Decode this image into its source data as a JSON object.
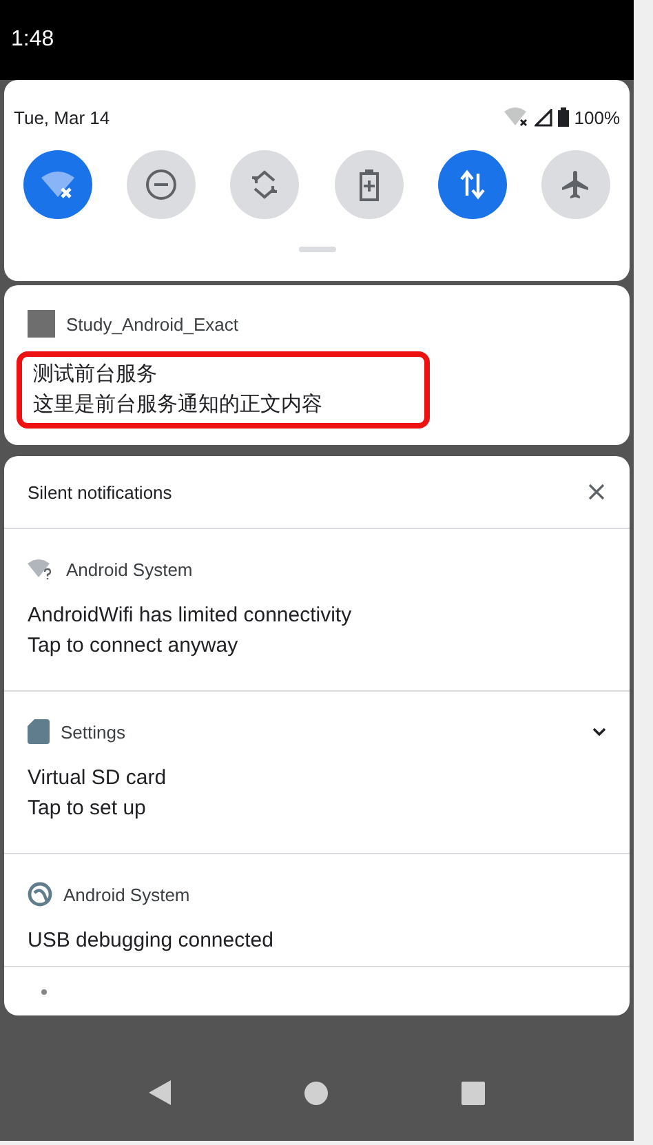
{
  "status_bar": {
    "time": "1:48"
  },
  "quick_settings": {
    "date": "Tue, Mar 14",
    "battery": "100%",
    "tiles": [
      {
        "kind": "wifi",
        "on": true
      },
      {
        "kind": "dnd",
        "on": false
      },
      {
        "kind": "rotate",
        "on": false
      },
      {
        "kind": "battery-saver",
        "on": false
      },
      {
        "kind": "data",
        "on": true
      },
      {
        "kind": "airplane",
        "on": false
      }
    ]
  },
  "foreground_notification": {
    "app": "Study_Android_Exact",
    "highlighted": true,
    "title": "测试前台服务",
    "text": "这里是前台服务通知的正文内容"
  },
  "silent_notifications": {
    "header": "Silent notifications",
    "items": [
      {
        "kind": "wifi-question",
        "app": "Android System",
        "expandable": false,
        "title": "AndroidWifi has limited connectivity",
        "text": "Tap to connect anyway"
      },
      {
        "kind": "sd-card",
        "app": "Settings",
        "expandable": true,
        "title": "Virtual SD card",
        "text": "Tap to set up"
      },
      {
        "kind": "bug",
        "app": "Android System",
        "expandable": false,
        "title": "USB debugging connected"
      }
    ]
  }
}
